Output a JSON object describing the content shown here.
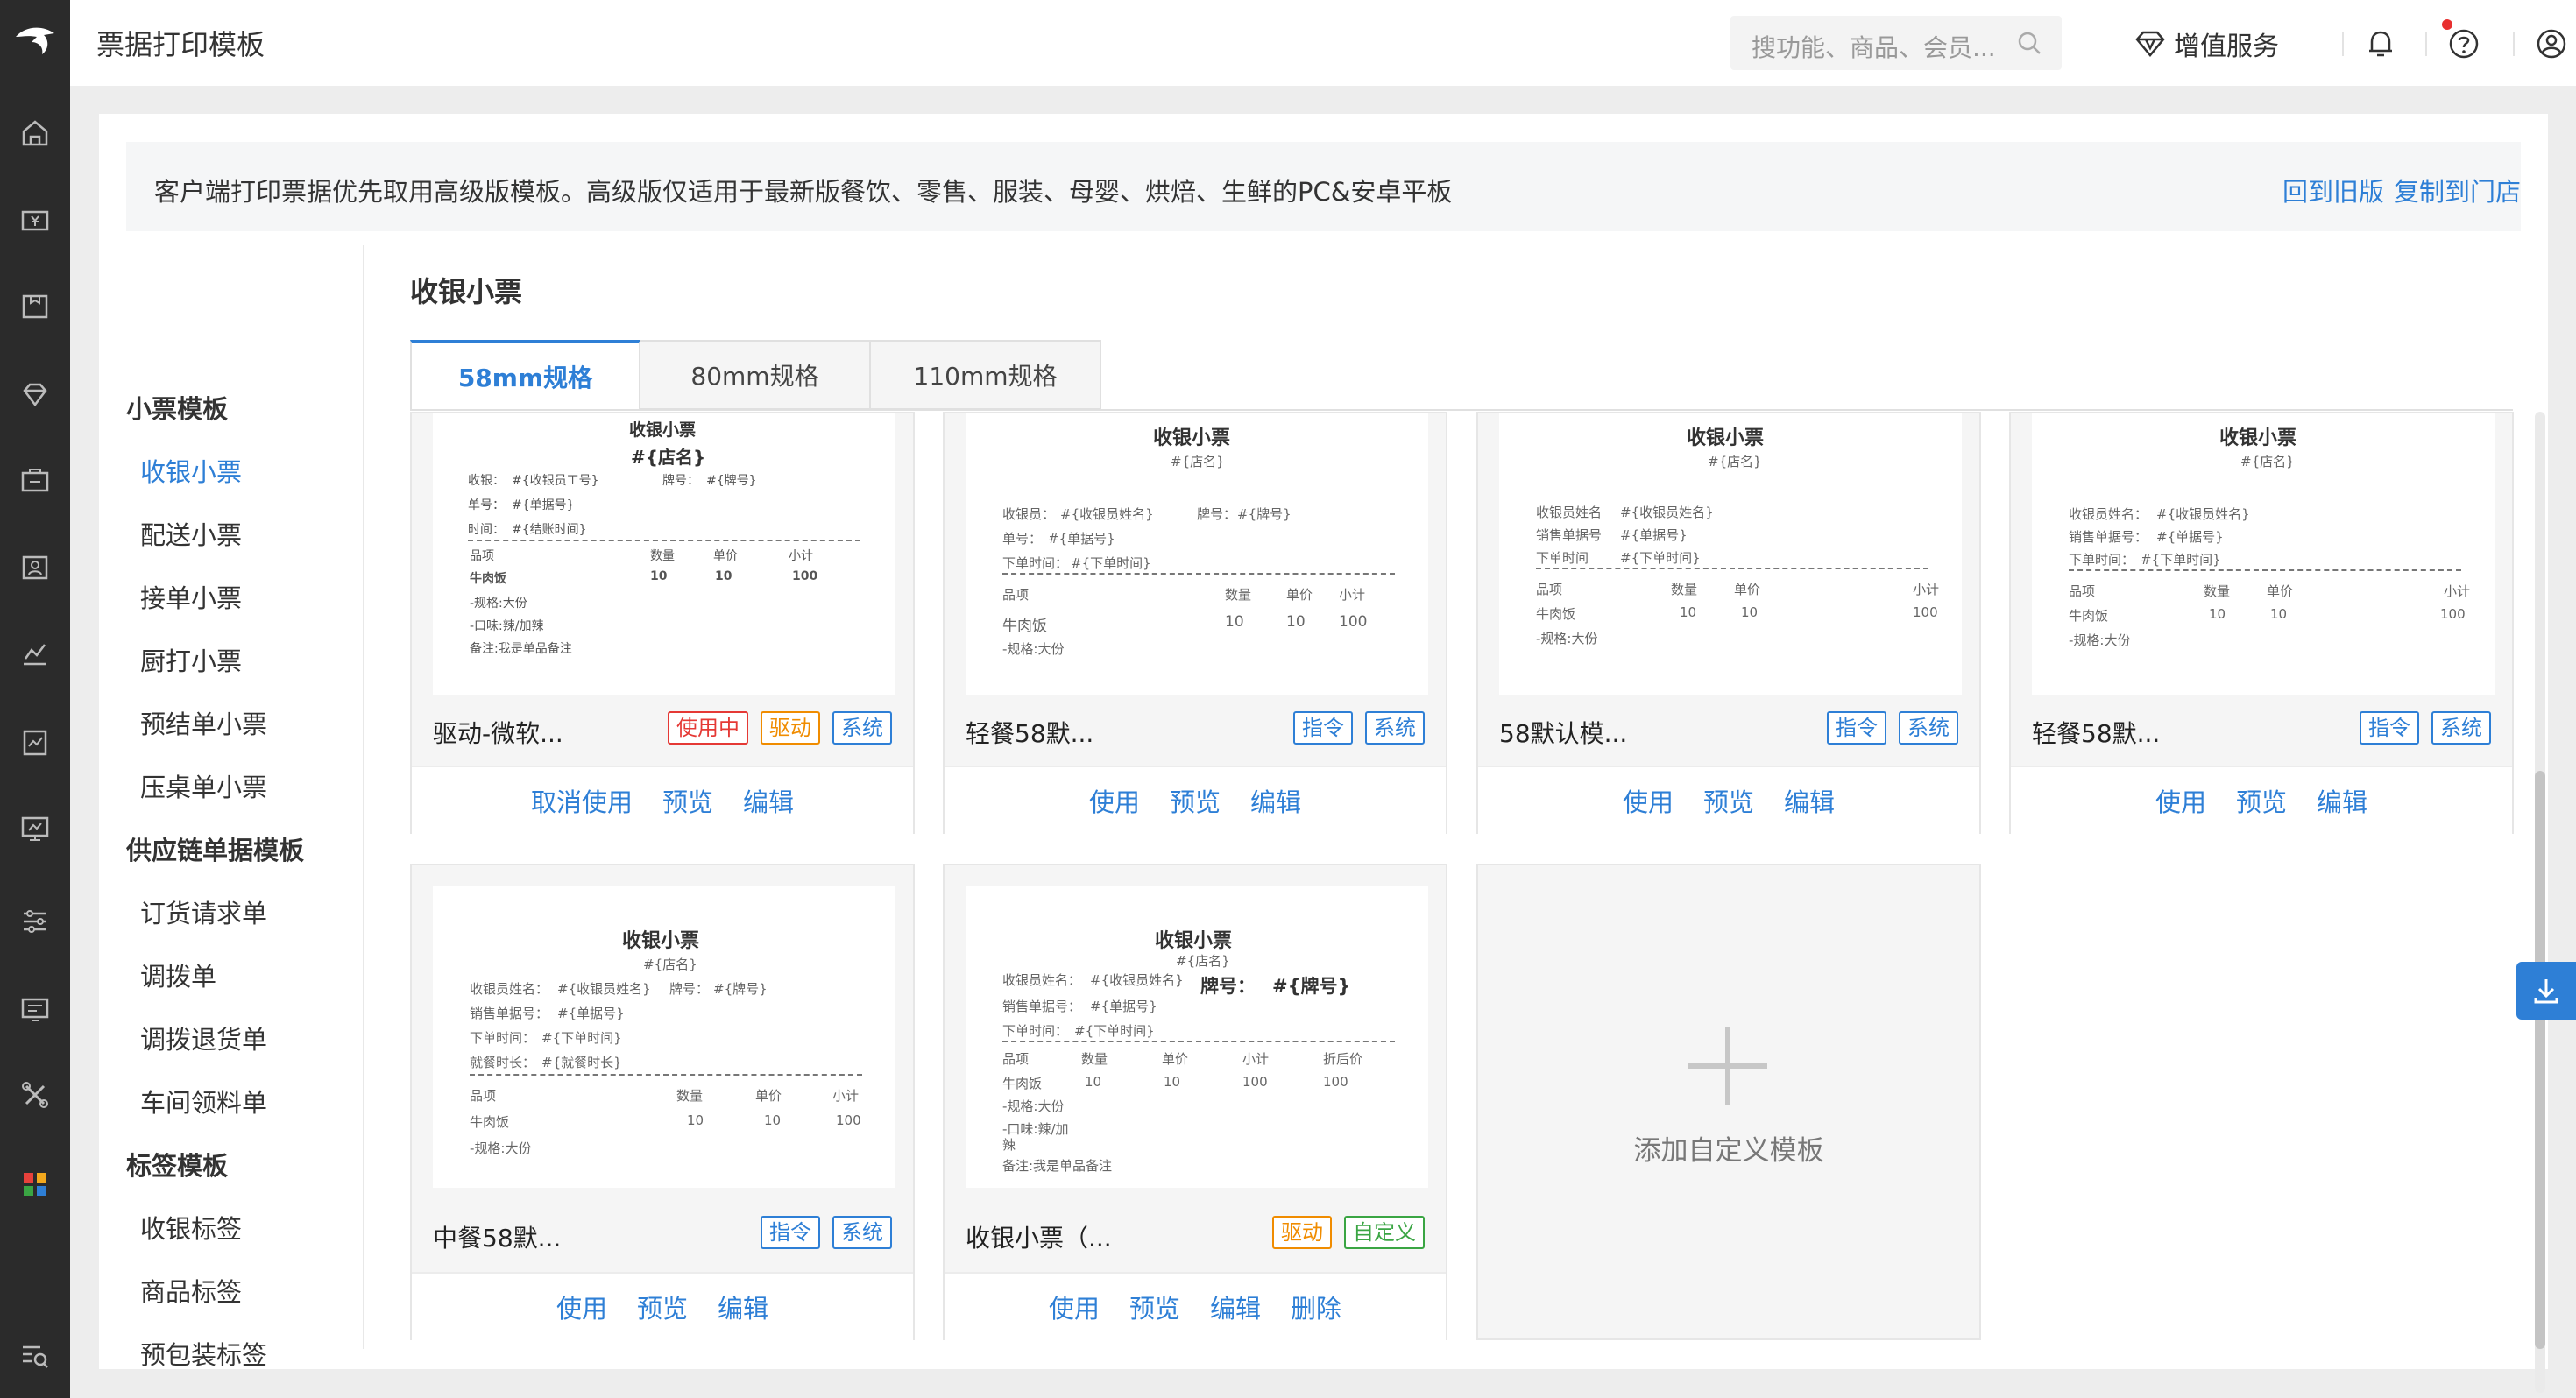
{
  "topbar": {
    "title": "票据打印模板",
    "search_placeholder": "搜功能、商品、会员...",
    "value_added": "增值服务"
  },
  "notice": {
    "text": "客户端打印票据优先取用高级版模板。高级版仅适用于最新版餐饮、零售、服装、母婴、烘焙、生鲜的PC&安卓平板",
    "link_old": "回到旧版",
    "link_copy": "复制到门店"
  },
  "subnav": {
    "group1": "小票模板",
    "g1_items": [
      "收银小票",
      "配送小票",
      "接单小票",
      "厨打小票",
      "预结单小票",
      "压桌单小票"
    ],
    "group2": "供应链单据模板",
    "g2_items": [
      "订货请求单",
      "调拨单",
      "调拨退货单",
      "车间领料单"
    ],
    "group3": "标签模板",
    "g3_items": [
      "收银标签",
      "商品标签",
      "预包装标签"
    ]
  },
  "section": {
    "title": "收银小票",
    "tabs": [
      "58mm规格",
      "80mm规格",
      "110mm规格"
    ]
  },
  "receipt": {
    "title": "收银小票",
    "store": "#{店名}",
    "cashier": "收银：",
    "cashier_val": "#{收银员工号}",
    "card_no": "牌号：",
    "card_no_val": "#{牌号}",
    "order": "单号：",
    "order_val": "#{单据号}",
    "time": "时间：",
    "time_val": "#{结账时间}",
    "cashier_name": "收银员：",
    "cashier_name_val": "#{收银员姓名}",
    "cashier_name2": "收银员姓名：",
    "cashier_name3": "收银员姓名",
    "sale_no": "销售单据号：",
    "sale_no2": "销售单据号",
    "order_time": "下单时间：",
    "order_time2": "下单时间",
    "order_time_val": "#{下单时间}",
    "dine_time": "就餐时长：",
    "dine_time_val": "#{就餐时长}",
    "col_item": "品项",
    "col_qty": "数量",
    "col_price": "单价",
    "col_sub": "小计",
    "col_disc": "折后价",
    "item_name": "牛肉饭",
    "qty": "10",
    "price": "10",
    "sub": "100",
    "disc": "100",
    "spec": "-规格:大份",
    "taste": "-口味:辣/加辣",
    "taste_a": "-口味:辣/加",
    "taste_b": "辣",
    "remark": "备注:我是单品备注",
    "big_card_no": "牌号：",
    "big_card_no_val": "#{牌号}"
  },
  "cards": [
    {
      "label": "驱动-微软...",
      "badges": [
        "使用中",
        "驱动",
        "系统"
      ],
      "actions": [
        "取消使用",
        "预览",
        "编辑"
      ]
    },
    {
      "label": "轻餐58默...",
      "badges": [
        "指令",
        "系统"
      ],
      "actions": [
        "使用",
        "预览",
        "编辑"
      ]
    },
    {
      "label": "58默认模...",
      "badges": [
        "指令",
        "系统"
      ],
      "actions": [
        "使用",
        "预览",
        "编辑"
      ]
    },
    {
      "label": "轻餐58默...",
      "badges": [
        "指令",
        "系统"
      ],
      "actions": [
        "使用",
        "预览",
        "编辑"
      ]
    },
    {
      "label": "中餐58默...",
      "badges": [
        "指令",
        "系统"
      ],
      "actions": [
        "使用",
        "预览",
        "编辑"
      ]
    },
    {
      "label": "收银小票（...",
      "badges": [
        "驱动",
        "自定义"
      ],
      "actions": [
        "使用",
        "预览",
        "编辑",
        "删除"
      ]
    }
  ],
  "add_card": {
    "label": "添加自定义模板"
  },
  "colors": {
    "accent": "#2e7fd6",
    "rail": "#2b2b2b",
    "in_use": "#e53935",
    "driver": "#f08c00",
    "custom": "#3aa543"
  }
}
